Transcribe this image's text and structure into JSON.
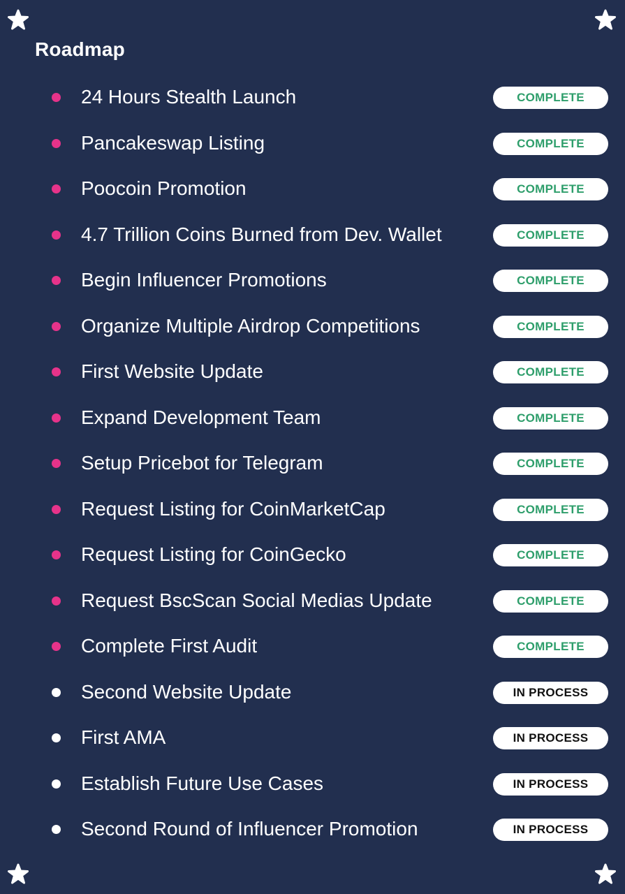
{
  "title": "Roadmap",
  "colors": {
    "background": "#222f4f",
    "complete_bullet": "#e6338a",
    "in_process_bullet": "#ffffff",
    "complete_text": "#2e9e6b",
    "in_process_text": "#111111"
  },
  "decorations": [
    "star-icon",
    "star-icon",
    "star-icon",
    "star-icon"
  ],
  "items": [
    {
      "label": "24 Hours Stealth Launch",
      "status": "COMPLETE"
    },
    {
      "label": "Pancakeswap Listing",
      "status": "COMPLETE"
    },
    {
      "label": "Poocoin Promotion",
      "status": "COMPLETE"
    },
    {
      "label": "4.7 Trillion Coins Burned from Dev. Wallet",
      "status": "COMPLETE"
    },
    {
      "label": "Begin Influencer Promotions",
      "status": "COMPLETE"
    },
    {
      "label": "Organize Multiple Airdrop Competitions",
      "status": "COMPLETE"
    },
    {
      "label": "First Website Update",
      "status": "COMPLETE"
    },
    {
      "label": "Expand Development Team",
      "status": "COMPLETE"
    },
    {
      "label": "Setup Pricebot for Telegram",
      "status": "COMPLETE"
    },
    {
      "label": "Request Listing for CoinMarketCap",
      "status": "COMPLETE"
    },
    {
      "label": "Request Listing for CoinGecko",
      "status": "COMPLETE"
    },
    {
      "label": "Request BscScan Social Medias Update",
      "status": "COMPLETE"
    },
    {
      "label": "Complete First Audit",
      "status": "COMPLETE"
    },
    {
      "label": "Second Website Update",
      "status": "IN PROCESS"
    },
    {
      "label": "First AMA",
      "status": "IN PROCESS"
    },
    {
      "label": "Establish Future Use Cases",
      "status": "IN PROCESS"
    },
    {
      "label": "Second Round of Influencer Promotion",
      "status": "IN PROCESS"
    }
  ]
}
